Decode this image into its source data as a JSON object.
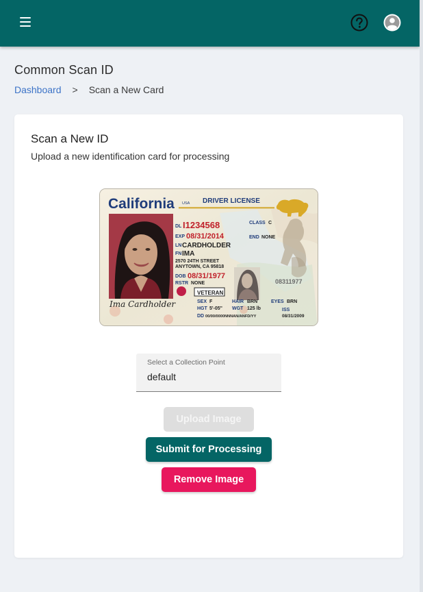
{
  "header": {
    "menu_icon": "hamburger-menu-icon",
    "help_icon": "help-circle-icon",
    "avatar_icon": "user-avatar-icon",
    "bar_color": "#046565"
  },
  "page": {
    "title": "Common Scan ID",
    "breadcrumb": {
      "home": "Dashboard",
      "separator": ">",
      "current": "Scan a New Card"
    }
  },
  "card": {
    "title": "Scan a New ID",
    "subtitle": "Upload a new identification card for processing"
  },
  "id_image": {
    "state": "California",
    "country": "USA",
    "doc_type": "DRIVER LICENSE",
    "dl_label": "DL",
    "dl_number": "I1234568",
    "class_label": "CLASS",
    "class_value": "C",
    "exp_label": "EXP",
    "exp_value": "08/31/2014",
    "end_label": "END",
    "end_value": "NONE",
    "ln_label": "LN",
    "last_name": "CARDHOLDER",
    "fn_label": "FN",
    "first_name": "IMA",
    "address1": "2570 24TH STREET",
    "address2": "ANYTOWN, CA 95818",
    "dob_label": "DOB",
    "dob_value": "08/31/1977",
    "rstr_label": "RSTR",
    "rstr_value": "NONE",
    "id_number": "08311977",
    "veteran": "VETERAN",
    "sex_label": "SEX",
    "sex_value": "F",
    "hair_label": "HAIR",
    "hair_value": "BRN",
    "eyes_label": "EYES",
    "eyes_value": "BRN",
    "hgt_label": "HGT",
    "hgt_value": "5'-05\"",
    "wgt_label": "WGT",
    "wgt_value": "125 lb",
    "dd_label": "DD",
    "dd_value": "00/00/0000NNNAN/ANFD/YY",
    "iss_label": "ISS",
    "iss_value": "08/31/2009",
    "signature": "Ima Cardholder"
  },
  "form": {
    "collection_point_label": "Select a Collection Point",
    "collection_point_value": "default"
  },
  "buttons": {
    "upload": "Upload Image",
    "submit": "Submit for Processing",
    "remove": "Remove Image"
  },
  "colors": {
    "primary": "#046565",
    "danger": "#e8175d",
    "link": "#3c73c7",
    "disabled": "#dedede"
  }
}
